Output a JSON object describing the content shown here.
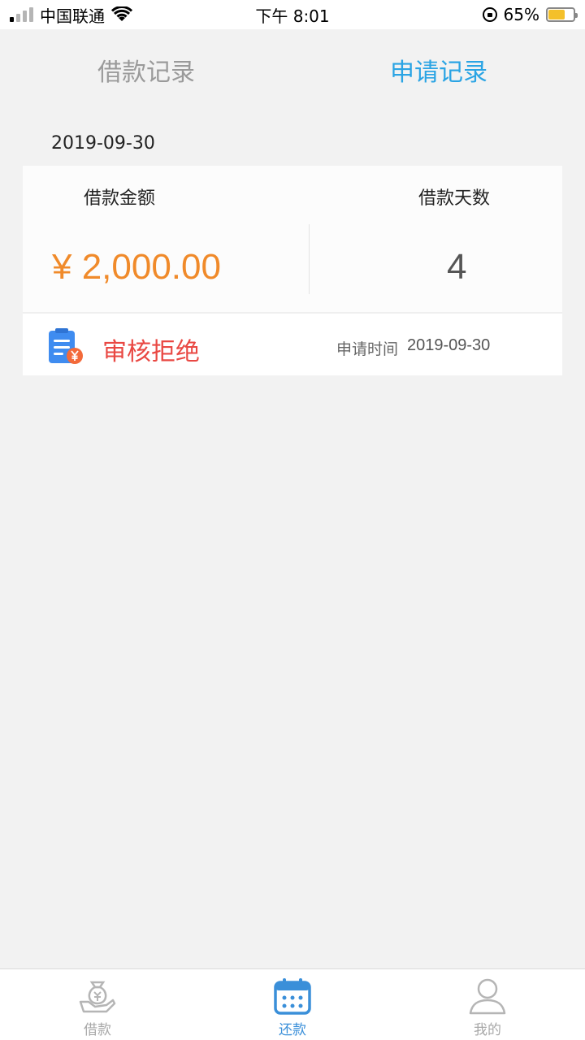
{
  "status_bar": {
    "carrier": "中国联通",
    "time": "下午 8:01",
    "battery": "65%",
    "battery_level": 0.65
  },
  "tabs": [
    {
      "label": "借款记录",
      "active": false
    },
    {
      "label": "申请记录",
      "active": true
    }
  ],
  "record": {
    "date": "2019-09-30",
    "amount_label": "借款金额",
    "days_label": "借款天数",
    "amount": "¥ 2,000.00",
    "days": "4",
    "status": "审核拒绝",
    "apply_time_label": "申请时间",
    "apply_time": "2019-09-30"
  },
  "bottom_nav": [
    {
      "label": "借款",
      "icon": "money-bag-icon",
      "active": false
    },
    {
      "label": "还款",
      "icon": "calendar-icon",
      "active": true
    },
    {
      "label": "我的",
      "icon": "user-icon",
      "active": false
    }
  ],
  "colors": {
    "accent": "#2aa4e4",
    "amount": "#f08a2a",
    "rejected": "#e94843",
    "nav_active": "#3a8fd9"
  }
}
